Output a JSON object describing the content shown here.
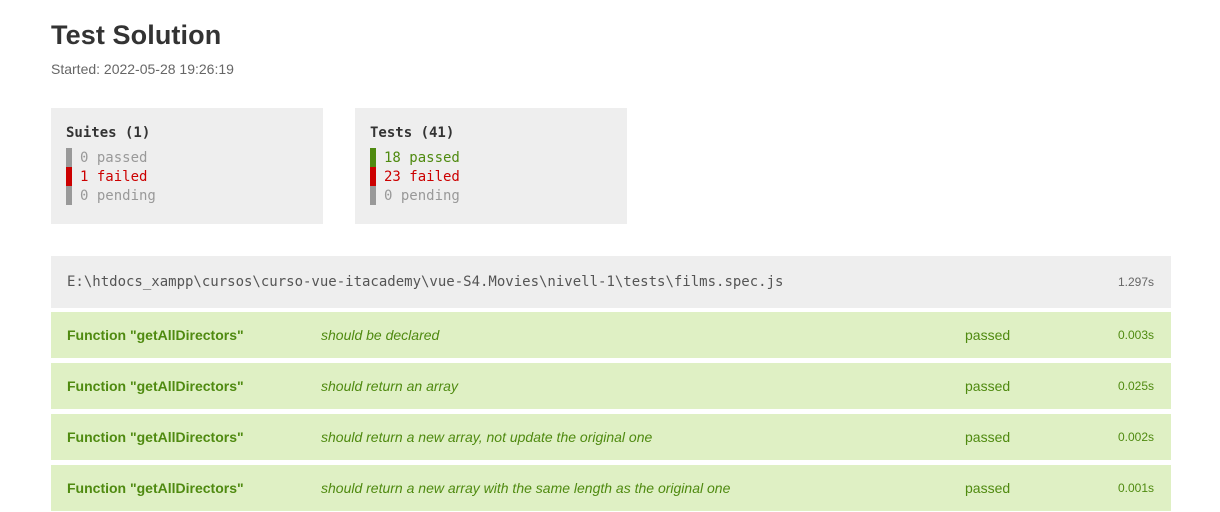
{
  "header": {
    "title": "Test Solution",
    "started": "Started: 2022-05-28 19:26:19"
  },
  "summary": {
    "suites": {
      "title": "Suites (1)",
      "passed": "0 passed",
      "failed": "1 failed",
      "pending": "0 pending"
    },
    "tests": {
      "title": "Tests (41)",
      "passed": "18 passed",
      "failed": "23 failed",
      "pending": "0 pending"
    }
  },
  "file": {
    "path": "E:\\htdocs_xampp\\cursos\\curso-vue-itacademy\\vue-S4.Movies\\nivell-1\\tests\\films.spec.js",
    "duration": "1.297s"
  },
  "tests": [
    {
      "suite": "Function \"getAllDirectors\"",
      "name": "should be declared",
      "status": "passed",
      "time": "0.003s"
    },
    {
      "suite": "Function \"getAllDirectors\"",
      "name": "should return an array",
      "status": "passed",
      "time": "0.025s"
    },
    {
      "suite": "Function \"getAllDirectors\"",
      "name": "should return a new array, not update the original one",
      "status": "passed",
      "time": "0.002s"
    },
    {
      "suite": "Function \"getAllDirectors\"",
      "name": "should return a new array with the same length as the original one",
      "status": "passed",
      "time": "0.001s"
    }
  ],
  "colors": {
    "passed": "#4f8a10",
    "failed": "#cc0000",
    "pending": "#999999",
    "row_passed_bg": "#dff0c4",
    "box_bg": "#eeeeee"
  }
}
